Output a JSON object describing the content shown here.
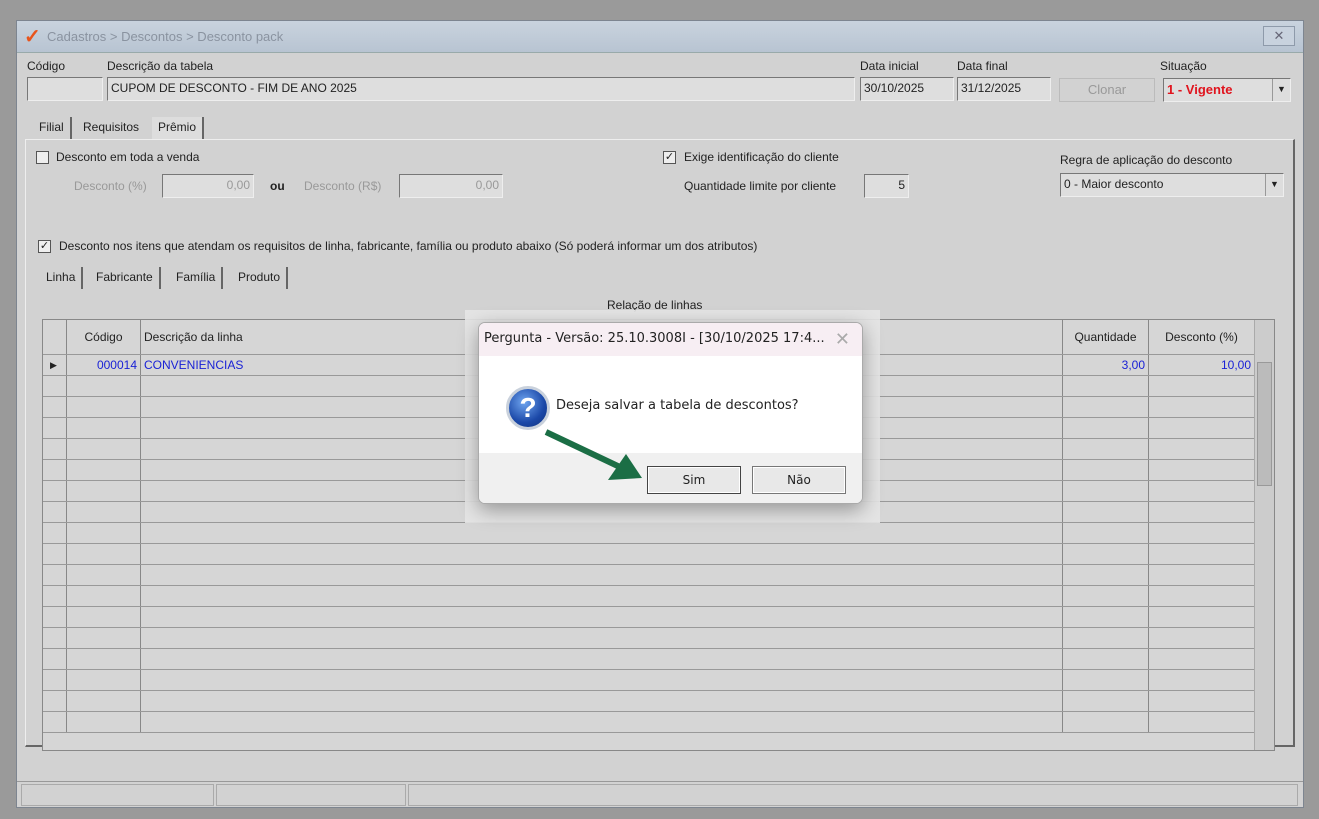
{
  "window": {
    "breadcrumb": "Cadastros > Descontos > Desconto pack",
    "close_icon": "close-icon"
  },
  "header": {
    "codigo_label": "Código",
    "codigo_value": "",
    "descricao_label": "Descrição da tabela",
    "descricao_value": "CUPOM DE DESCONTO - FIM DE ANO 2025",
    "data_inicial_label": "Data inicial",
    "data_inicial_value": "30/10/2025",
    "data_final_label": "Data final",
    "data_final_value": "31/12/2025",
    "clonar_label": "Clonar",
    "situacao_label": "Situação",
    "situacao_value": "1 - Vigente",
    "situacao_color": "#e0141e"
  },
  "tabs": [
    "Filial",
    "Requisitos",
    "Prêmio"
  ],
  "premio": {
    "desconto_toda_venda_label": "Desconto em toda a venda",
    "desconto_toda_venda_checked": false,
    "desconto_pct_label": "Desconto (%)",
    "desconto_pct_value": "0,00",
    "ou_label": "ou",
    "desconto_rs_label": "Desconto (R$)",
    "desconto_rs_value": "0,00",
    "exige_id_label": "Exige identificação do cliente",
    "exige_id_checked": true,
    "qtd_limite_label": "Quantidade limite por cliente",
    "qtd_limite_value": "5",
    "regra_label": "Regra de aplicação do desconto",
    "regra_value": "0 - Maior desconto",
    "itens_label": "Desconto nos itens que atendam os requisitos de linha, fabricante, família ou produto abaixo (Só poderá informar um dos atributos)",
    "itens_checked": true
  },
  "subtabs": [
    "Linha",
    "Fabricante",
    "Família",
    "Produto"
  ],
  "grid": {
    "title": "Relação de linhas",
    "columns": [
      "Código",
      "Descrição da linha",
      "Quantidade",
      "Desconto (%)"
    ],
    "rows": [
      {
        "codigo": "000014",
        "descricao": "CONVENIENCIAS",
        "quantidade": "3,00",
        "desconto": "10,00"
      }
    ]
  },
  "dialog": {
    "title": "Pergunta - Versão: 25.10.3008I - [30/10/2025 17:4...",
    "message": "Deseja salvar a tabela de descontos?",
    "icon": "question-icon",
    "yes_label": "Sim",
    "no_label": "Não",
    "arrow_color": "#1b6e45"
  }
}
